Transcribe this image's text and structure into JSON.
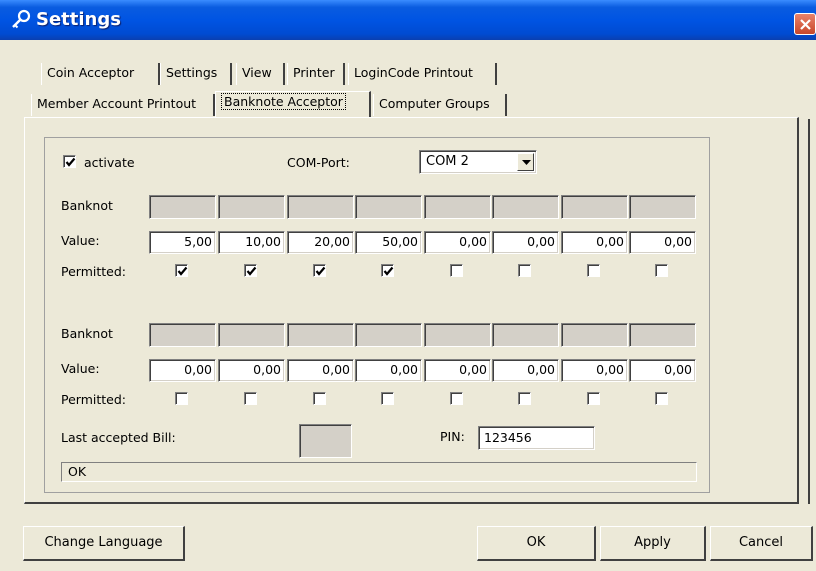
{
  "window": {
    "title": "Settings"
  },
  "tabs": {
    "row1": [
      "Coin Acceptor",
      "Settings",
      "View",
      "Printer",
      "LoginCode Printout"
    ],
    "row2": [
      "Member Account Printout",
      "Banknote Acceptor",
      "Computer Groups"
    ],
    "active": "Banknote Acceptor"
  },
  "acceptor": {
    "activate_label": "activate",
    "activate_checked": true,
    "com_port_label": "COM-Port:",
    "com_port_value": "COM 2"
  },
  "group1": {
    "banknote_label": "Banknot",
    "value_label": "Value:",
    "permitted_label": "Permitted:",
    "values": [
      "5,00",
      "10,00",
      "20,00",
      "50,00",
      "0,00",
      "0,00",
      "0,00",
      "0,00"
    ],
    "permitted": [
      true,
      true,
      true,
      true,
      false,
      false,
      false,
      false
    ]
  },
  "group2": {
    "banknote_label": "Banknot",
    "value_label": "Value:",
    "permitted_label": "Permitted:",
    "values": [
      "0,00",
      "0,00",
      "0,00",
      "0,00",
      "0,00",
      "0,00",
      "0,00",
      "0,00"
    ],
    "permitted": [
      false,
      false,
      false,
      false,
      false,
      false,
      false,
      false
    ]
  },
  "last_bill": {
    "label": "Last accepted Bill:",
    "value": ""
  },
  "pin": {
    "label": "PIN:",
    "value": "123456"
  },
  "status": {
    "text": "OK"
  },
  "buttons": {
    "change_language": "Change Language",
    "ok": "OK",
    "apply": "Apply",
    "cancel": "Cancel"
  },
  "colors": {
    "title_bar": "#0054E3",
    "dialog_bg": "#ECE9D8",
    "close_button": "#D8583A"
  },
  "icons": {
    "title": "key-icon",
    "close": "close-icon",
    "dropdown": "chevron-down-icon",
    "check": "check-icon"
  }
}
